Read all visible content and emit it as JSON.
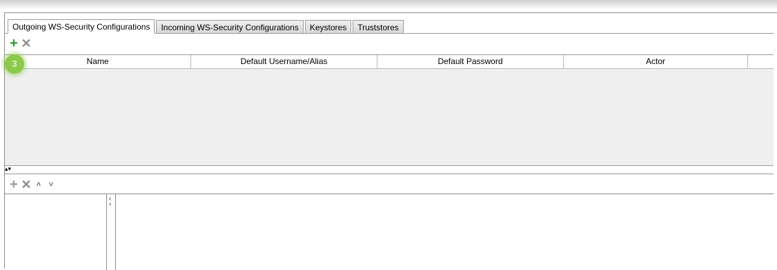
{
  "tabs": [
    {
      "label": "Outgoing WS-Security Configurations",
      "active": true
    },
    {
      "label": "Incoming WS-Security Configurations",
      "active": false
    },
    {
      "label": "Keystores",
      "active": false
    },
    {
      "label": "Truststores",
      "active": false
    }
  ],
  "toolbar_top": {
    "add_glyph": "+",
    "remove_glyph": "✕"
  },
  "table": {
    "columns": [
      "Name",
      "Default Username/Alias",
      "Default Password",
      "Actor"
    ]
  },
  "step_badge": "3",
  "splitter": {
    "glyph": "▴▾"
  },
  "toolbar_bottom": {
    "add_glyph": "+",
    "remove_glyph": "✕",
    "up_glyph": "˄",
    "down_glyph": "˅"
  },
  "collapse": {
    "left_glyph": "‹",
    "right_glyph": "›"
  },
  "colors": {
    "add_green": "#2e9a2e",
    "badge_green": "#8cc94a",
    "grid_bg": "#efefef"
  }
}
